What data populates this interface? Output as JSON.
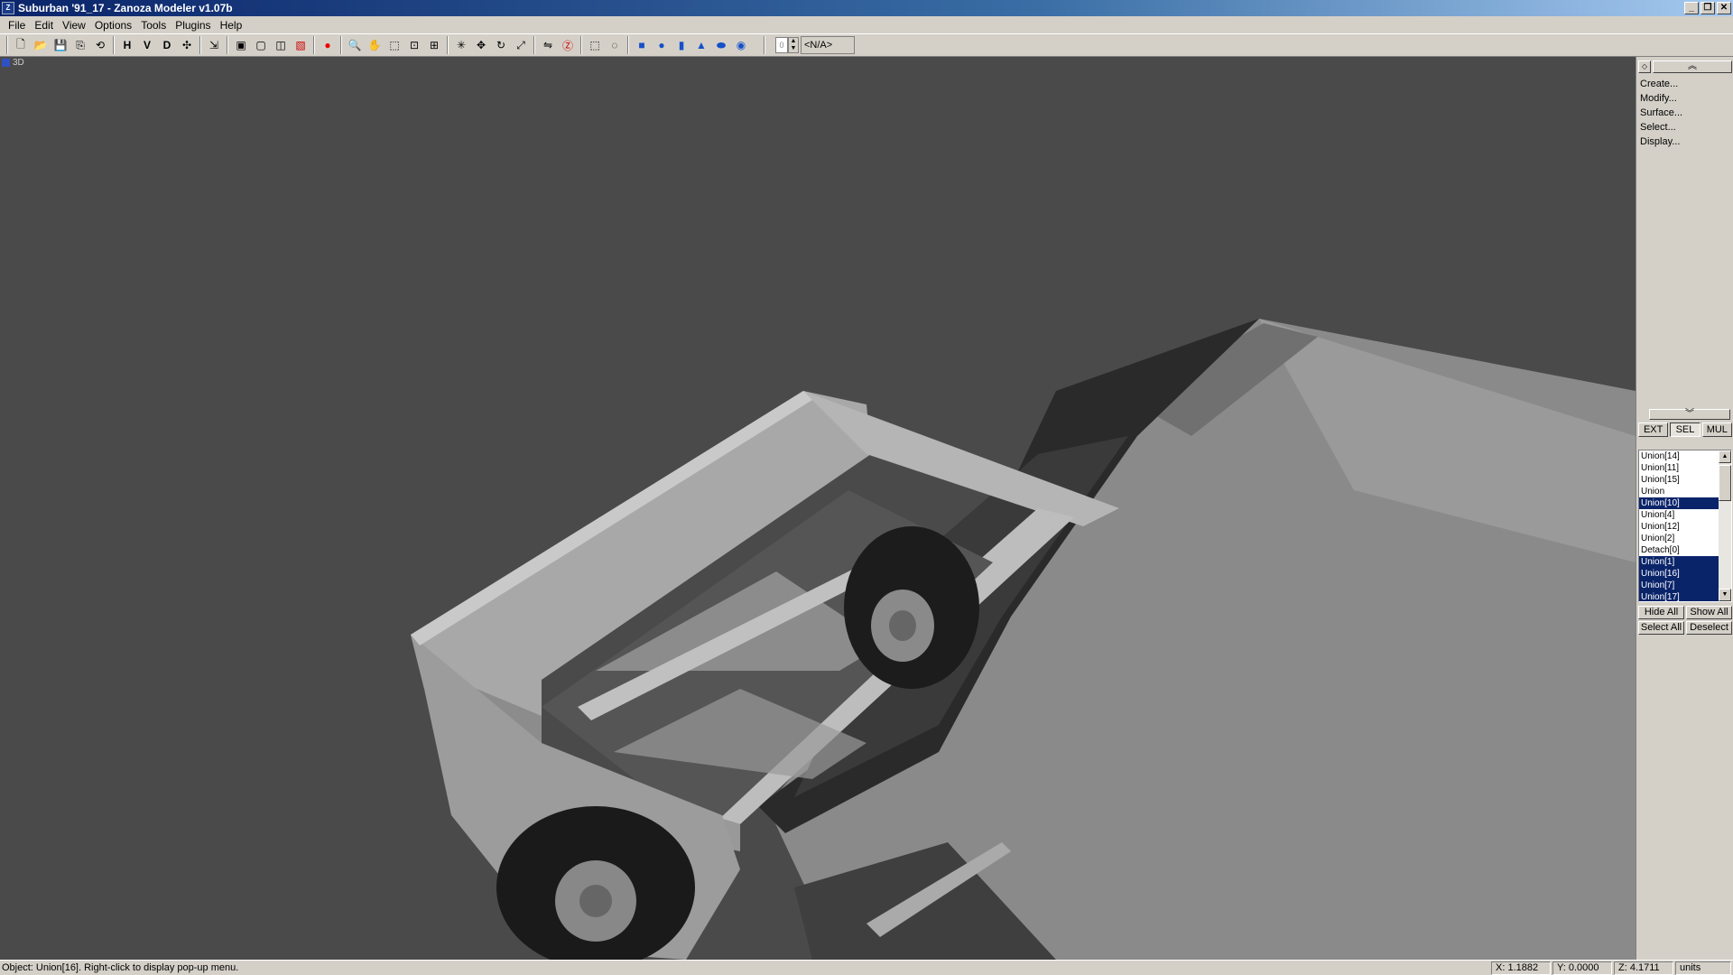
{
  "window": {
    "title": "Suburban '91_17 - Zanoza Modeler v1.07b"
  },
  "menu": [
    "File",
    "Edit",
    "View",
    "Options",
    "Tools",
    "Plugins",
    "Help"
  ],
  "toolbar": {
    "view_h": "H",
    "view_v": "V",
    "view_d": "D",
    "spinner_value": "0",
    "field_value": "<N/A>"
  },
  "viewport": {
    "label": "3D"
  },
  "panel": {
    "rollouts": [
      "Create...",
      "Modify...",
      "Surface...",
      "Select...",
      "Display..."
    ],
    "modes": [
      "EXT",
      "SEL",
      "MUL"
    ],
    "objects": [
      {
        "name": "Union[14]",
        "selected": false
      },
      {
        "name": "Union[11]",
        "selected": false
      },
      {
        "name": "Union[15]",
        "selected": false
      },
      {
        "name": "Union",
        "selected": false
      },
      {
        "name": "Union[10]",
        "selected": true
      },
      {
        "name": "Union[4]",
        "selected": false
      },
      {
        "name": "Union[12]",
        "selected": false
      },
      {
        "name": "Union[2]",
        "selected": false
      },
      {
        "name": "Detach[0]",
        "selected": false
      },
      {
        "name": "Union[1]",
        "selected": true
      },
      {
        "name": "Union[16]",
        "selected": true
      },
      {
        "name": "Union[7]",
        "selected": true
      },
      {
        "name": "Union[17]",
        "selected": true
      }
    ],
    "hide_all": "Hide All",
    "show_all": "Show All",
    "select_all": "Select All",
    "deselect": "Deselect"
  },
  "status": {
    "message": "Object: Union[16]. Right-click to display pop-up menu.",
    "x": "X: 1.1882",
    "y": "Y: 0.0000",
    "z": "Z: 4.1711",
    "units": "units"
  }
}
